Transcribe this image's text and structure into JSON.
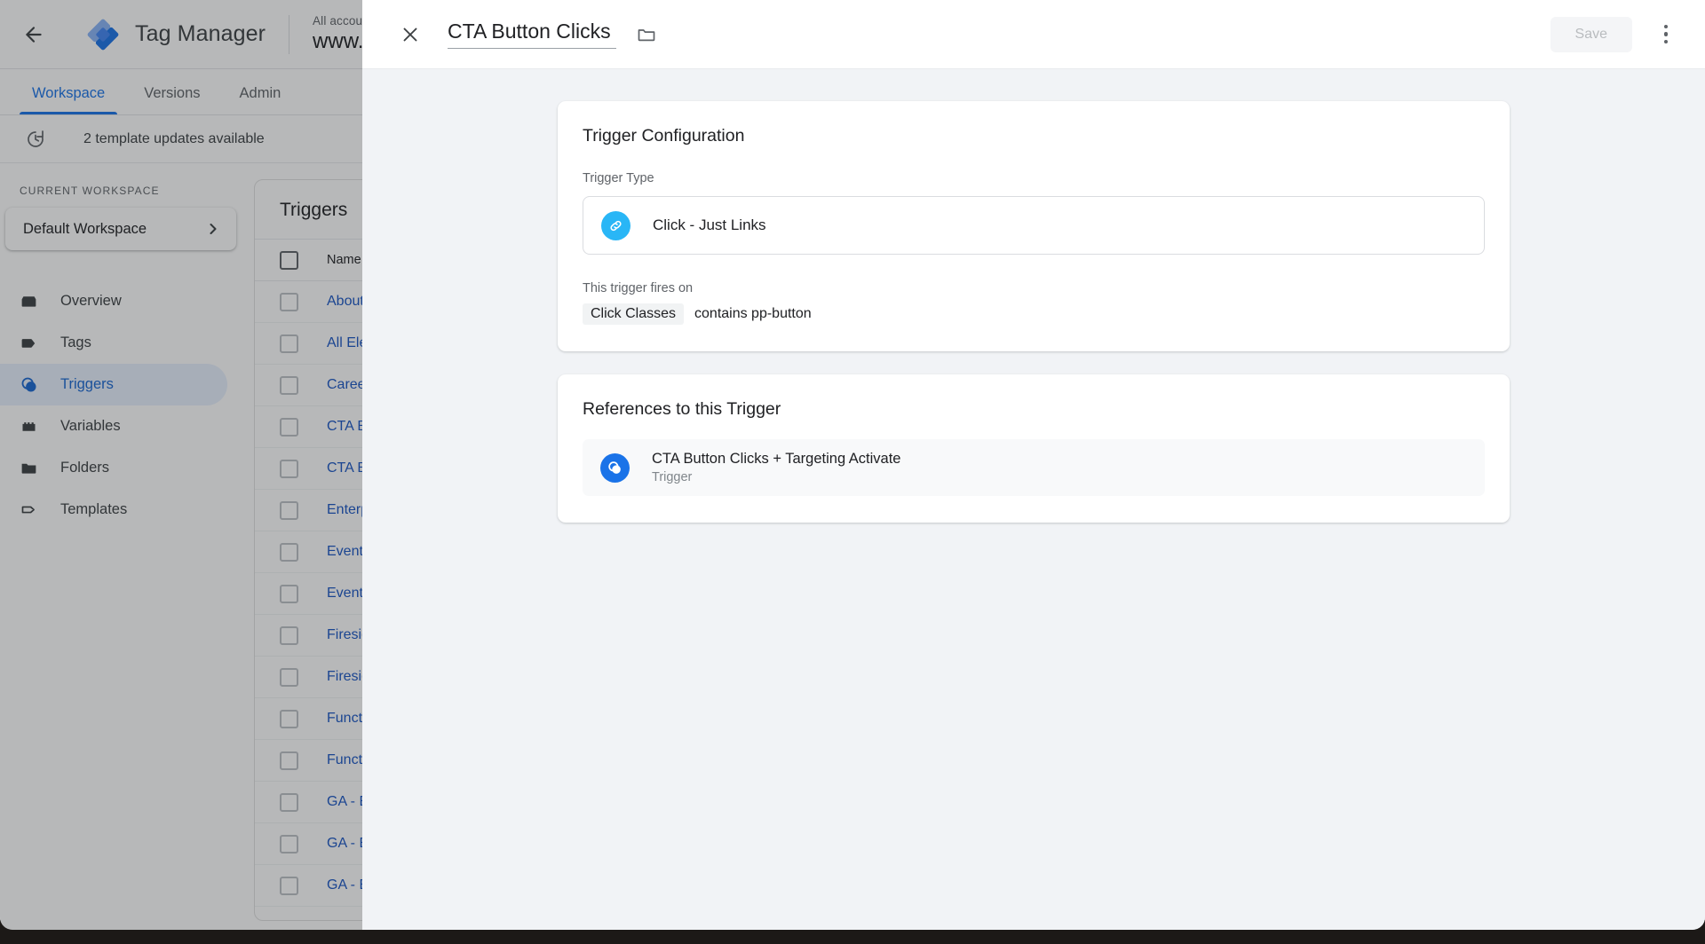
{
  "app": {
    "back_icon": "back-arrow-icon",
    "logo_icon": "tag-manager-logo-icon",
    "title": "Tag Manager",
    "account_breadcrumb": "All accounts > Pe",
    "container_name": "www.peb",
    "nav_tabs": [
      {
        "label": "Workspace",
        "active": true
      },
      {
        "label": "Versions",
        "active": false
      },
      {
        "label": "Admin",
        "active": false
      }
    ],
    "notice": {
      "icon": "update-history-icon",
      "text": "2 template updates available"
    }
  },
  "sidebar": {
    "heading": "CURRENT WORKSPACE",
    "workspace": {
      "name": "Default Workspace",
      "chevron_icon": "chevron-right-icon"
    },
    "items": [
      {
        "label": "Overview",
        "icon": "overview-icon",
        "active": false
      },
      {
        "label": "Tags",
        "icon": "tag-icon",
        "active": false
      },
      {
        "label": "Triggers",
        "icon": "trigger-icon",
        "active": true
      },
      {
        "label": "Variables",
        "icon": "variables-icon",
        "active": false
      },
      {
        "label": "Folders",
        "icon": "folder-icon",
        "active": false
      },
      {
        "label": "Templates",
        "icon": "template-tag-icon",
        "active": false
      }
    ]
  },
  "triggers_panel": {
    "title": "Triggers",
    "column_name": "Name",
    "sort_icon": "arrow-up-icon",
    "rows": [
      {
        "name": "About U"
      },
      {
        "name": "All Elem"
      },
      {
        "name": "Careers"
      },
      {
        "name": "CTA Bu"
      },
      {
        "name": "CTA Bu"
      },
      {
        "name": "Enterpr"
      },
      {
        "name": "Event –"
      },
      {
        "name": "Event –"
      },
      {
        "name": "Fireside"
      },
      {
        "name": "Fireside"
      },
      {
        "name": "Functio"
      },
      {
        "name": "Functio"
      },
      {
        "name": "GA - Ev"
      },
      {
        "name": "GA - Ev"
      },
      {
        "name": "GA - Ev"
      }
    ]
  },
  "dialog": {
    "close_icon": "close-icon",
    "title": "CTA Button Clicks",
    "folder_icon": "folder-outline-icon",
    "save_label": "Save",
    "save_disabled": true,
    "kebab_icon": "more-vert-icon",
    "trigger_configuration": {
      "card_title": "Trigger Configuration",
      "trigger_type_label": "Trigger Type",
      "trigger_type_icon": "link-click-icon",
      "trigger_type_value": "Click - Just Links",
      "fires_on_label": "This trigger fires on",
      "condition_variable": "Click Classes",
      "condition_text": "contains pp-button"
    },
    "references": {
      "card_title": "References to this Trigger",
      "items": [
        {
          "icon": "trigger-icon",
          "name": "CTA Button Clicks + Targeting Activate",
          "type": "Trigger"
        }
      ]
    }
  },
  "colors": {
    "accent_blue": "#1a73e8",
    "link_blue": "#1a56c4",
    "light_blue": "#29b6f6",
    "scrim": "rgba(32,33,36,.32)",
    "dialog_bg": "#f1f3f6"
  }
}
